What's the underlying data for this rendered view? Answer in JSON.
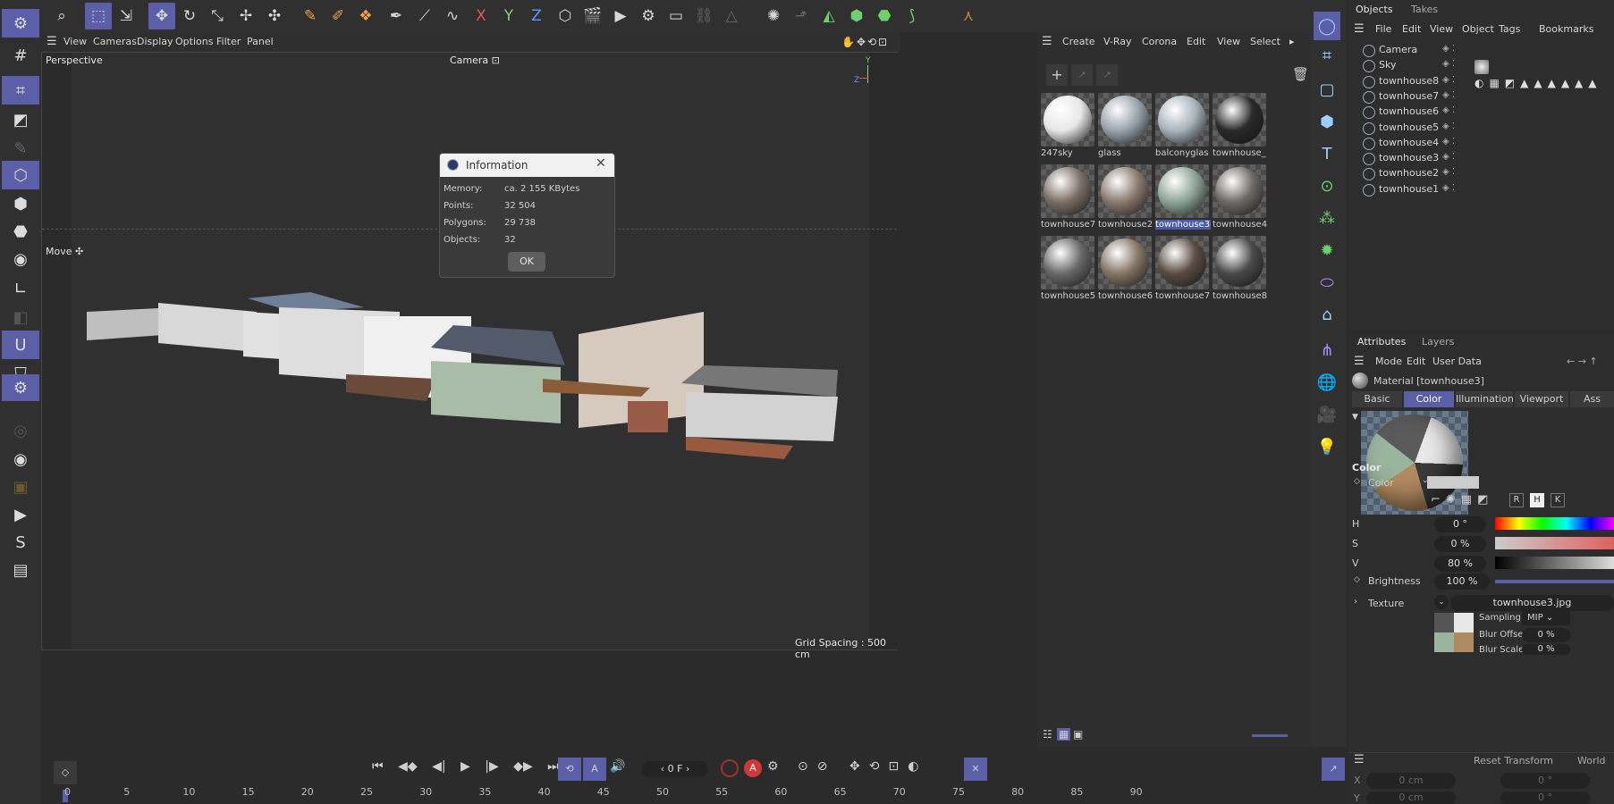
{
  "toolbar": {
    "icons": [
      "search-icon",
      "live-selection-icon",
      "select-tool-icon",
      "move-icon",
      "rotate-icon",
      "scale-icon",
      "transform-icon",
      "axis-transform-icon",
      "spline-pen-icon",
      "spline-sketch-icon",
      "spline-smooth-icon",
      "paint-brush-icon",
      "knife-icon",
      "sculpt-icon"
    ],
    "x_axis": "X",
    "y_axis": "Y",
    "z_axis": "Z"
  },
  "viewport": {
    "menu": [
      "View",
      "Cameras",
      "Display",
      "Options",
      "Filter",
      "Panel"
    ],
    "name": "Perspective",
    "camera": "Camera",
    "tool_label": "Move",
    "grid_spacing": "Grid Spacing : 500 cm"
  },
  "dialog": {
    "title": "Information",
    "rows": [
      {
        "label": "Memory:",
        "value": "ca. 2 155 KBytes"
      },
      {
        "label": "Points:",
        "value": "32 504"
      },
      {
        "label": "Polygons:",
        "value": "29 738"
      },
      {
        "label": "Objects:",
        "value": "32"
      }
    ],
    "ok": "OK"
  },
  "materials": {
    "menu": [
      "Create",
      "V-Ray",
      "Corona",
      "Edit",
      "View",
      "Select"
    ],
    "items": [
      {
        "name": "247sky",
        "color": "#e8e8e8"
      },
      {
        "name": "glass",
        "color": "#9aa4ad"
      },
      {
        "name": "balconyglas",
        "color": "#a9b4bc"
      },
      {
        "name": "townhouse_",
        "color": "#2a2a2a"
      },
      {
        "name": "townhouse7",
        "color": "#7a6f66"
      },
      {
        "name": "townhouse2",
        "color": "#8a7a70"
      },
      {
        "name": "townhouse3",
        "color": "#8fa598"
      },
      {
        "name": "townhouse4",
        "color": "#6f6a68"
      },
      {
        "name": "townhouse5",
        "color": "#6a6a6a"
      },
      {
        "name": "townhouse6",
        "color": "#857566"
      },
      {
        "name": "townhouse7",
        "color": "#5a4d44"
      },
      {
        "name": "townhouse8",
        "color": "#4a4a4a"
      }
    ],
    "selected_index": 6
  },
  "objects": {
    "tabs": [
      "Objects",
      "Takes"
    ],
    "menu": [
      "File",
      "Edit",
      "View",
      "Object",
      "Tags",
      "Bookmarks"
    ],
    "rows": [
      "Camera",
      "Sky",
      "townhouse8",
      "townhouse7",
      "townhouse6",
      "townhouse5",
      "townhouse4",
      "townhouse3",
      "townhouse2",
      "townhouse1"
    ]
  },
  "attributes": {
    "tabs": [
      "Attributes",
      "Layers"
    ],
    "menu": [
      "Mode",
      "Edit",
      "User Data"
    ],
    "material_title": "Material [townhouse3]",
    "subtabs": [
      "Basic",
      "Color",
      "Illumination",
      "Viewport",
      "Ass"
    ],
    "active_subtab": "Color",
    "section": "Color",
    "color_label": "Color",
    "h_label": "H",
    "h_value": "0 °",
    "s_label": "S",
    "s_value": "0 %",
    "v_label": "V",
    "v_value": "80 %",
    "brightness_label": "Brightness",
    "brightness_value": "100 %",
    "texture_label": "Texture",
    "texture_value": "townhouse3.jpg",
    "sampling_label": "Sampling",
    "sampling_value": "MIP",
    "blur_offset_label": "Blur Offset",
    "blur_offset_value": "0 %",
    "blur_scale_label": "Blur Scale",
    "blur_scale_value": "0 %",
    "mode_buttons": [
      "R",
      "H",
      "K"
    ]
  },
  "coords": {
    "reset": "Reset Transform",
    "world": "World",
    "x_label": "X",
    "x_value": "0 cm",
    "x_value2": "0 °",
    "y_label": "Y",
    "y_value": "0 cm",
    "y_value2": "0 °"
  },
  "timeline": {
    "frame": "0 F",
    "ticks": [
      "0",
      "5",
      "10",
      "15",
      "20",
      "25",
      "30",
      "35",
      "40",
      "45",
      "50",
      "55",
      "60",
      "65",
      "70",
      "75",
      "80",
      "85",
      "90"
    ]
  }
}
